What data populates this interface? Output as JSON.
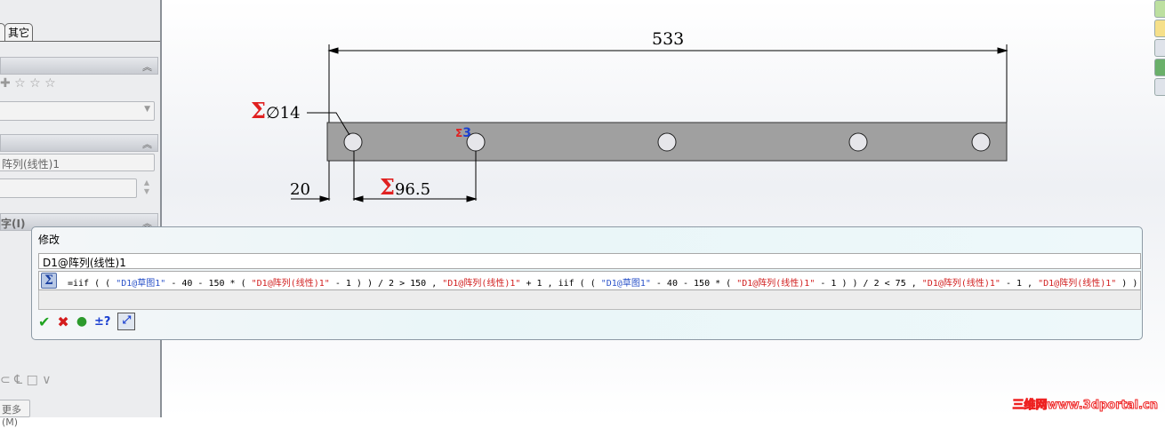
{
  "left_panel": {
    "tab_label": "其它",
    "section2_value": "阵列(线性)1",
    "section3_title": "字(I)",
    "more_button": "更多(M)"
  },
  "drawing": {
    "overall_dim": "533",
    "diameter_dim": "∅14",
    "sigma": "Σ",
    "count_dim": "3",
    "edge_dim": "20",
    "spacing_dim": "96.5",
    "hole_count": 5,
    "colors": {
      "bar": "#a0a0a0",
      "sigma": "#e02020",
      "count": "#1a3fd0"
    }
  },
  "dialog": {
    "title": "修改",
    "name_value": "D1@阵列(线性)1",
    "formula_prefix": "=iif ( ( ",
    "formula_parts": [
      {
        "t": "\"D1@草图1\"",
        "c": "blue"
      },
      {
        "t": " - 40 - 150 * ( ",
        "c": ""
      },
      {
        "t": "\"D1@阵列(线性)1\"",
        "c": "red"
      },
      {
        "t": " - 1 ) ) / 2 > 150 , ",
        "c": ""
      },
      {
        "t": "\"D1@阵列(线性)1\"",
        "c": "red"
      },
      {
        "t": " + 1 , iif ( ( ",
        "c": ""
      },
      {
        "t": "\"D1@草图1\"",
        "c": "blue"
      },
      {
        "t": " - 40 - 150 * ( ",
        "c": ""
      },
      {
        "t": "\"D1@阵列(线性)1\"",
        "c": "red"
      },
      {
        "t": " - 1 ) ) / 2 < 75 , ",
        "c": ""
      },
      {
        "t": "\"D1@阵列(线性)1\"",
        "c": "red"
      },
      {
        "t": " - 1 , ",
        "c": ""
      },
      {
        "t": "\"D1@阵列(线性)1\"",
        "c": "red"
      },
      {
        "t": " ) )",
        "c": ""
      }
    ],
    "sigma_icon": "Σ",
    "buttons": {
      "ok": "✔",
      "cancel": "✖",
      "rebuild": "●",
      "tolerance": "±?"
    }
  },
  "watermark": "三维网www.3dportal.cn"
}
